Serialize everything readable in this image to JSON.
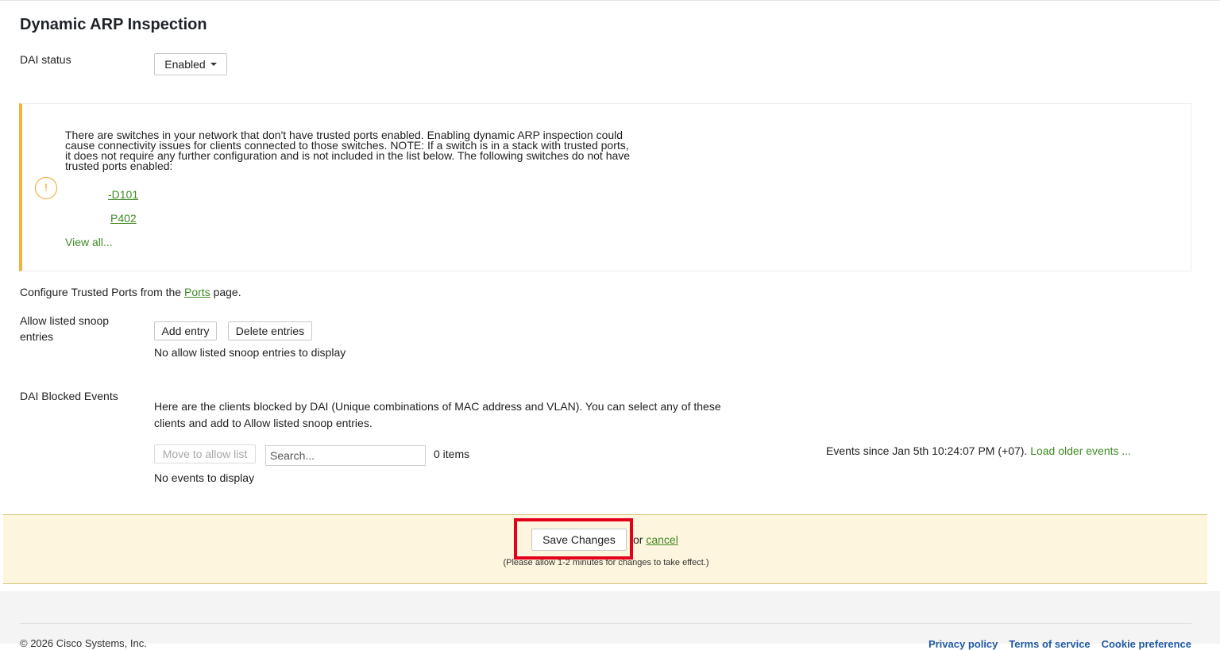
{
  "page_title": "Dynamic ARP Inspection",
  "dai_status": {
    "label": "DAI status",
    "value": "Enabled"
  },
  "warning": {
    "message": "There are switches in your network that don't have trusted ports enabled. Enabling dynamic ARP inspection could cause connectivity issues for clients connected to those switches. NOTE: If a switch is in a stack with trusted ports, it does not require any further configuration and is not included in the list below. The following switches do not have trusted ports enabled:",
    "switches": [
      "-D101",
      "P402"
    ],
    "view_all": "View all...",
    "icon": "!"
  },
  "trusted_ports": {
    "prefix": "Configure Trusted Ports from the",
    "link": "Ports",
    "suffix": "page."
  },
  "snoop": {
    "label": "Allow listed snoop entries",
    "add_button": "Add entry",
    "delete_button": "Delete entries",
    "empty": "No allow listed snoop entries to display"
  },
  "blocked": {
    "label": "DAI Blocked Events",
    "description": "Here are the clients blocked by DAI (Unique combinations of MAC address and VLAN). You can select any of these clients and add to Allow listed snoop entries.",
    "move_button": "Move to allow list",
    "search_placeholder": "Search...",
    "items_count": "0 items",
    "events_since": "Events since Jan 5th 10:24:07 PM (+07).",
    "load_older": "Load older events ...",
    "empty": "No events to display"
  },
  "save_bar": {
    "save_button": "Save Changes",
    "or_text": "or",
    "cancel": "cancel",
    "note": "(Please allow 1-2 minutes for changes to take effect.)"
  },
  "footer": {
    "copyright": "© 2026 Cisco Systems, Inc.",
    "links": [
      "Privacy policy",
      "Terms of service",
      "Cookie preference"
    ]
  },
  "colors": {
    "accent_link": "#3f8a25",
    "warning_border": "#f0b43c",
    "save_bar_bg": "#fdf5dd",
    "highlight": "#e3001b",
    "footer_link": "#1f5aa6"
  }
}
